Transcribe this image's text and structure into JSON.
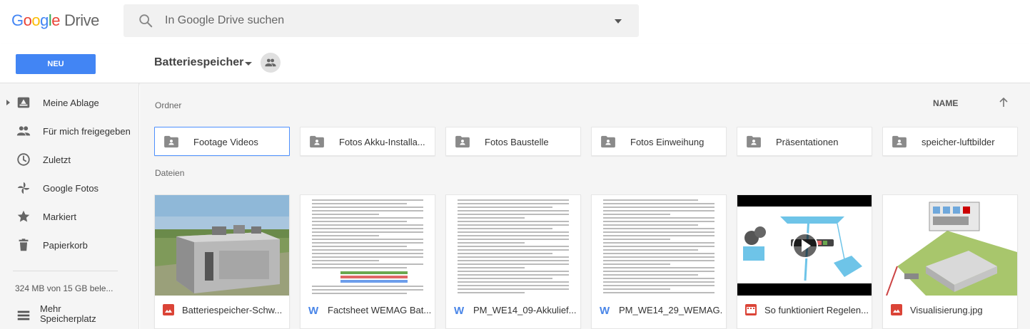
{
  "header": {
    "logo_google": "Google",
    "logo_drive": "Drive",
    "search_placeholder": "In Google Drive suchen"
  },
  "toolbar": {
    "new_label": "NEU",
    "folder_title": "Batteriespeicher"
  },
  "sidebar": {
    "items": [
      {
        "label": "Meine Ablage",
        "icon": "drive-icon"
      },
      {
        "label": "Für mich freigegeben",
        "icon": "people-icon"
      },
      {
        "label": "Zuletzt",
        "icon": "clock-icon"
      },
      {
        "label": "Google Fotos",
        "icon": "pinwheel-icon"
      },
      {
        "label": "Markiert",
        "icon": "star-icon"
      },
      {
        "label": "Papierkorb",
        "icon": "trash-icon"
      }
    ],
    "storage": "324 MB von 15 GB bele...",
    "more_storage": "Mehr Speicherplatz"
  },
  "main": {
    "folders_label": "Ordner",
    "files_label": "Dateien",
    "sort_label": "NAME",
    "folders": [
      {
        "name": "Footage Videos"
      },
      {
        "name": "Fotos Akku-Installa..."
      },
      {
        "name": "Fotos Baustelle"
      },
      {
        "name": "Fotos Einweihung"
      },
      {
        "name": "Präsentationen"
      },
      {
        "name": "speicher-luftbilder"
      }
    ],
    "files": [
      {
        "name": "Batteriespeicher-Schw...",
        "type": "image"
      },
      {
        "name": "Factsheet WEMAG Bat...",
        "type": "word"
      },
      {
        "name": "PM_WE14_09-Akkulief...",
        "type": "word"
      },
      {
        "name": "PM_WE14_29_WEMAG...",
        "type": "word"
      },
      {
        "name": "So funktioniert Regelen...",
        "type": "video"
      },
      {
        "name": "Visualisierung.jpg",
        "type": "image"
      }
    ]
  },
  "colors": {
    "accent": "#4285f4",
    "image_red": "#db4437",
    "word_blue": "#4a86e8"
  }
}
